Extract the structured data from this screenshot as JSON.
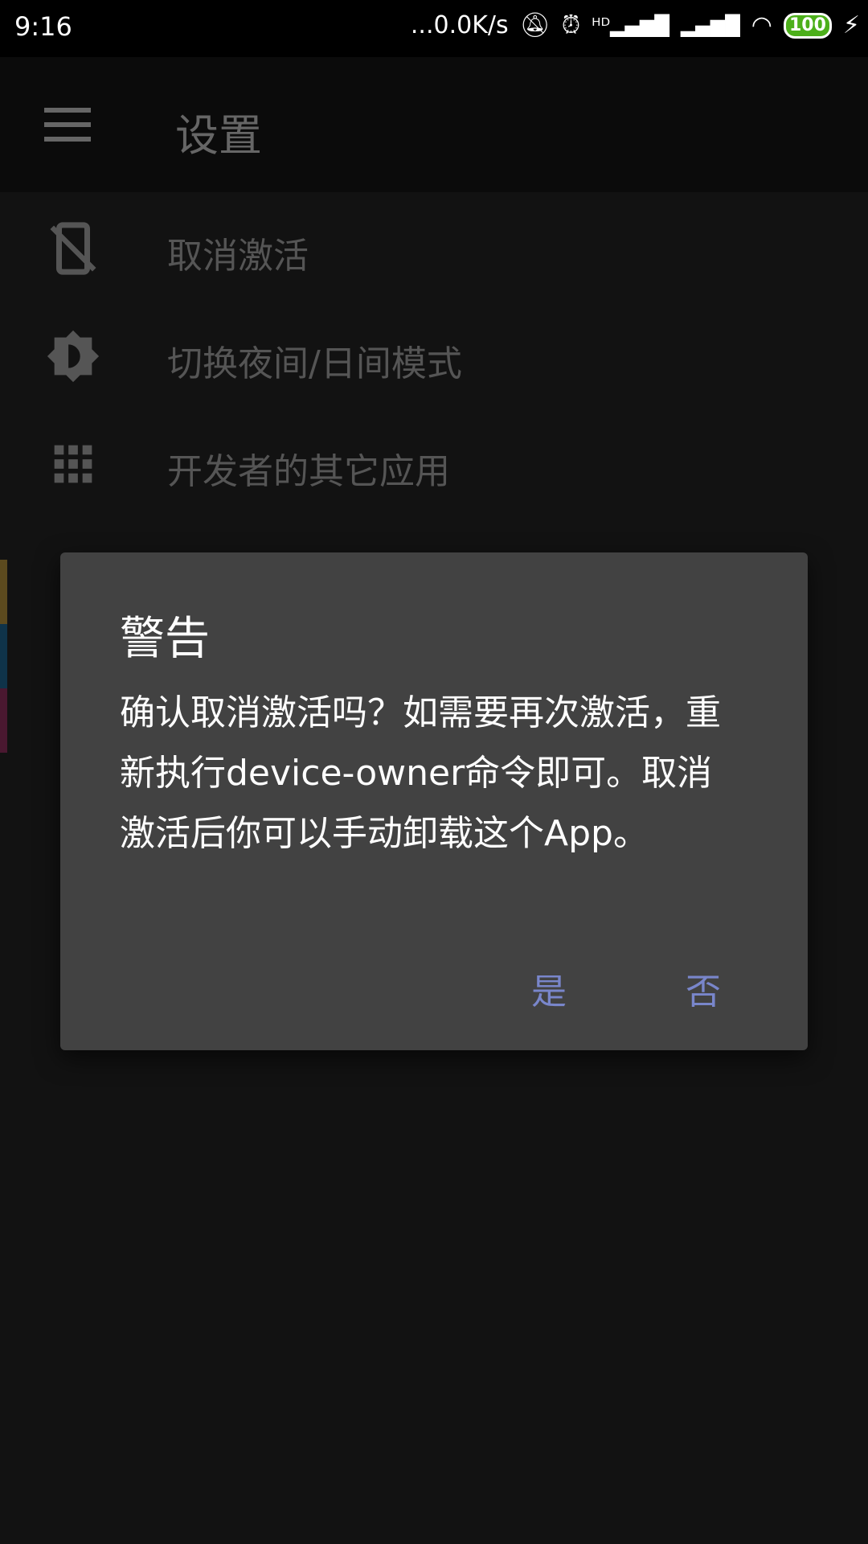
{
  "status_bar": {
    "time": "9:16",
    "network_speed": "...0.0K/s",
    "battery": "100",
    "icons": [
      "mute-icon",
      "alarm-icon",
      "hd-signal-icon",
      "signal-icon",
      "wifi-icon",
      "battery-icon",
      "charging-icon"
    ]
  },
  "toolbar": {
    "title": "设置",
    "menu_icon": "hamburger-icon"
  },
  "menu": {
    "items": [
      {
        "label": "取消激活",
        "icon": "phone-off-icon"
      },
      {
        "label": "切换夜间/日间模式",
        "icon": "brightness-icon"
      },
      {
        "label": "开发者的其它应用",
        "icon": "apps-grid-icon"
      }
    ]
  },
  "side_strips": {
    "colors": [
      "#5c4a1e",
      "#0f3349",
      "#4a1830"
    ]
  },
  "dialog": {
    "title": "警告",
    "message": "确认取消激活吗？如需要再次激活，重新执行device-owner命令即可。取消激活后你可以手动卸载这个App。",
    "positive": "是",
    "negative": "否",
    "accent": "#7986cb",
    "background": "#424242"
  }
}
